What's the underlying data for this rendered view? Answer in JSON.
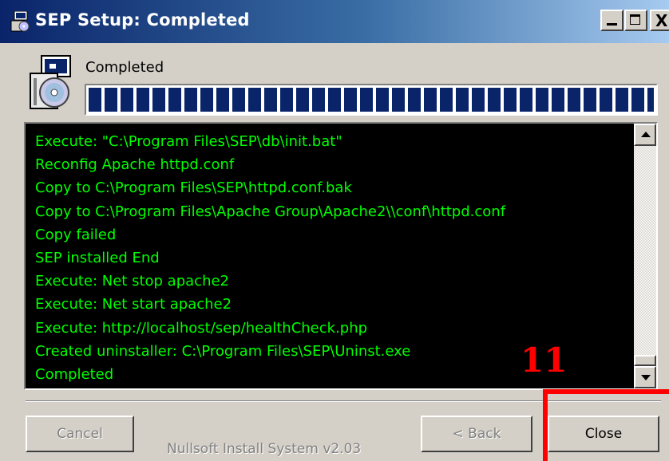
{
  "window": {
    "title": "SEP Setup: Completed",
    "controls": {
      "minimize_icon": "minimize-icon",
      "maximize_icon": "maximize-icon",
      "close_icon": "close-icon",
      "close_glyph": "X"
    }
  },
  "status": {
    "label": "Completed",
    "progress_percent": 100
  },
  "log": {
    "lines": [
      "Execute: \"C:\\Program Files\\SEP\\db\\init.bat\"",
      "Reconfig Apache httpd.conf",
      "Copy to C:\\Program Files\\SEP\\httpd.conf.bak",
      "Copy to C:\\Program Files\\Apache Group\\Apache2\\\\conf\\httpd.conf",
      "Copy failed",
      "SEP installed End",
      "Execute: Net stop apache2",
      "Execute: Net start apache2",
      "Execute: http://localhost/sep/healthCheck.php",
      "Created uninstaller: C:\\Program Files\\SEP\\Uninst.exe",
      "Completed"
    ],
    "text_color": "#00ff00",
    "background": "#000000"
  },
  "footer": {
    "cancel_label": "Cancel",
    "branding": "Nullsoft Install System v2.03",
    "back_label": "< Back",
    "close_label": "Close"
  },
  "annotation": {
    "number": "11",
    "color": "#ff0000"
  },
  "colors": {
    "titlebar_start": "#0a246a",
    "titlebar_end": "#a6caf0",
    "face": "#d4d0c8"
  }
}
